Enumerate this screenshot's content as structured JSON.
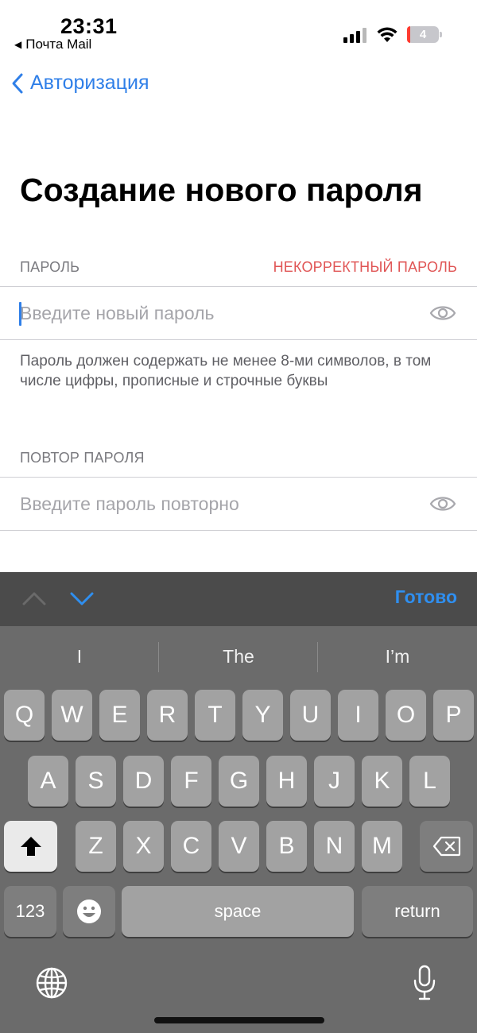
{
  "status_bar": {
    "time": "23:31",
    "back_app": "Почта Mail",
    "battery": "4",
    "colors": {
      "battery_low": "#ff3b30"
    }
  },
  "nav": {
    "back_label": "Авторизация",
    "accent": "#2f7fe8"
  },
  "title": "Создание нового пароля",
  "password": {
    "label": "ПАРОЛЬ",
    "error": "НЕКОРРЕКТНЫЙ ПАРОЛЬ",
    "value": "",
    "placeholder": "Введите новый пароль",
    "hint": "Пароль должен содержать не менее 8-ми символов, в том числе цифры, прописные и строчные буквы",
    "icon": "eye-icon"
  },
  "password_repeat": {
    "label": "ПОВТОР ПАРОЛЯ",
    "value": "",
    "placeholder": "Введите пароль повторно",
    "icon": "eye-icon"
  },
  "keyboard": {
    "toolbar": {
      "done": "Готово",
      "prev_icon": "chevron-up-icon",
      "next_icon": "chevron-down-icon"
    },
    "suggestions": [
      "I",
      "The",
      "I’m"
    ],
    "row1": [
      "Q",
      "W",
      "E",
      "R",
      "T",
      "Y",
      "U",
      "I",
      "O",
      "P"
    ],
    "row2": [
      "A",
      "S",
      "D",
      "F",
      "G",
      "H",
      "J",
      "K",
      "L"
    ],
    "row3": [
      "Z",
      "X",
      "C",
      "V",
      "B",
      "N",
      "M"
    ],
    "numbers": "123",
    "space": "space",
    "return": "return",
    "icons": {
      "shift": "shift-icon",
      "delete": "backspace-icon",
      "emoji": "emoji-icon",
      "globe": "globe-icon",
      "mic": "microphone-icon"
    }
  }
}
